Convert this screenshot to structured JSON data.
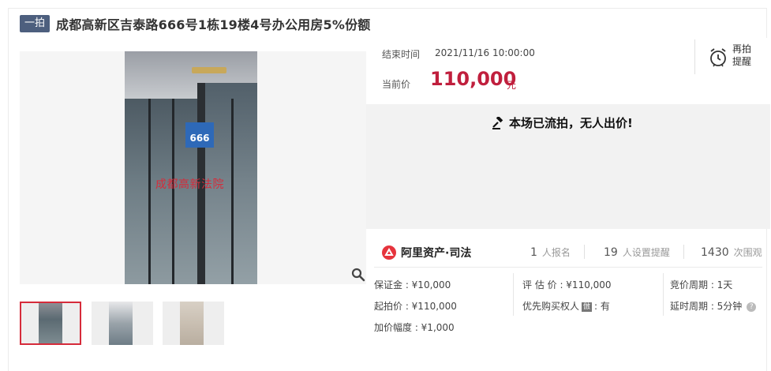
{
  "header": {
    "tag": "一拍",
    "title": "成都高新区吉泰路666号1栋19楼4号办公用房5%份额"
  },
  "gallery": {
    "watermark": "成都高新法院",
    "sign_number": "666"
  },
  "auction": {
    "end_time_label": "结束时间",
    "end_time": "2021/11/16 10:00:00",
    "current_price_label": "当前价",
    "current_price": "110,000",
    "price_unit": "元",
    "remind_line1": "再拍",
    "remind_line2": "提醒",
    "status": "本场已流拍，无人出价!"
  },
  "platform": {
    "logo_text": "阿里资产·司法"
  },
  "stats": {
    "signups": "1",
    "signups_label": "人报名",
    "reminders": "19",
    "reminders_label": "人设置提醒",
    "views": "1430",
    "views_label": "次围观"
  },
  "details": {
    "deposit": "保证金 : ¥10,000",
    "start_price": "起拍价 : ¥110,000",
    "increment": "加价幅度 : ¥1,000",
    "appraisal": "评 估 价 : ¥110,000",
    "priority_label": "优先购买权人",
    "priority_badge": "倣",
    "priority_value": ": 有",
    "bid_cycle": "竞价周期 : 1天",
    "extension": "延时周期 : 5分钟",
    "help": "?"
  },
  "colors": {
    "accent": "#c01f3d",
    "tag_bg": "#4d5f7e",
    "status_bg": "#f2f2f2"
  }
}
